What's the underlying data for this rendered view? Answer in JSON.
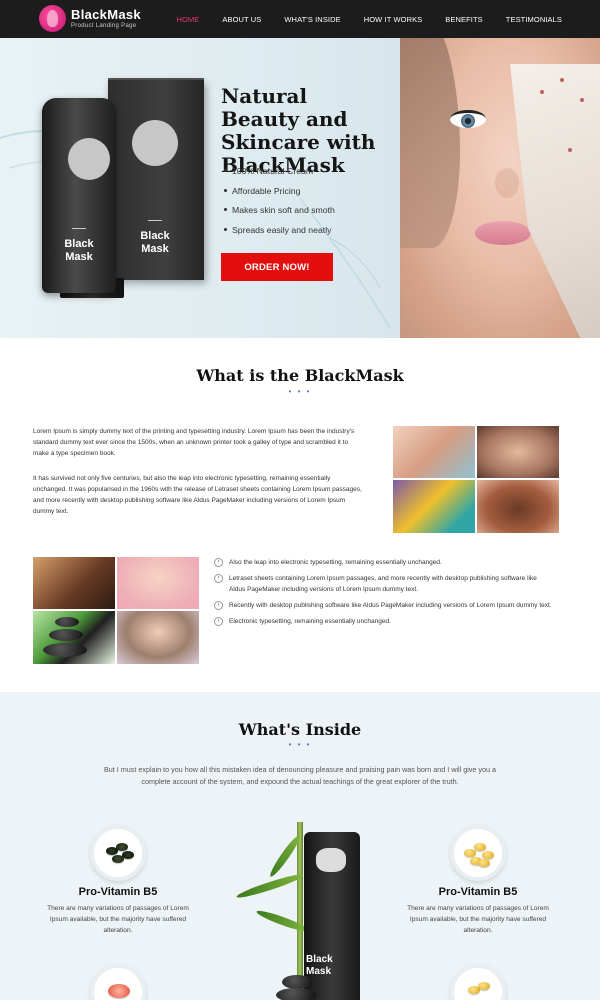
{
  "brand": {
    "name": "BlackMask",
    "tagline": "Product Landing Page"
  },
  "nav": {
    "items": [
      "HOME",
      "ABOUT US",
      "WHAT'S INSIDE",
      "HOW IT WORKS",
      "BENEFITS",
      "TESTIMONIALS"
    ],
    "active": "HOME"
  },
  "hero": {
    "title": "Natural Beauty and Skincare with BlackMask",
    "bullets": [
      "100% Natural Cream",
      "Affordable Pricing",
      "Makes skin soft and smoth",
      "Spreads easily and neatly"
    ],
    "cta": "ORDER NOW!",
    "product_label": "Black Mask"
  },
  "about": {
    "title": "What is the BlackMask",
    "dots": "• • •",
    "para1": "Lorem Ipsum is simply dummy text of the printing and typesetting industry. Lorem Ipsum has been the industry's standard dummy text ever since the 1500s, when an unknown printer took a galley of type and scrambled it to make a type specimen book.",
    "para2": "It has survived not only five centuries, but also the leap into electronic typesetting, remaining essentially unchanged. It was popularised in the 1960s with the release of Letraset sheets containing Lorem Ipsum passages, and more recently with desktop publishing software like Aldus PageMaker including versions of Lorem Ipsum dummy text.",
    "checklist": [
      "Also the leap into electronic typesetting, remaining essentially unchanged.",
      "Letraset sheets containing Lorem Ipsum passages, and more recently with desktop publishing software like Aldus PageMaker including versions of Lorem Ipsum dummy text.",
      "Recently with desktop publishing software like Aldus PageMaker including versions of Lorem Ipsum dummy text.",
      "Electronic typesetting, remaining essentially unchanged."
    ],
    "check_glyph": "›"
  },
  "inside": {
    "title": "What's Inside",
    "dots": "• • •",
    "intro": "But I must explain to you how all this mistaken idea of denouncing pleasure and praising pain was born and I will give you a complete account of the system, and expound the actual teachings of the great explorer of the truth.",
    "features": [
      {
        "title": "Pro-Vitamin B5",
        "desc": "There are many variations of passages of Lorem Ipsum available, but the majority have suffered alteration."
      },
      {
        "title": "Pro-Vitamin B5",
        "desc": "There are many variations of passages of Lorem Ipsum available, but the majority have suffered alteration."
      }
    ],
    "center_label": "Black Mask"
  },
  "colors": {
    "accent": "#e8377a",
    "cta": "#e30e0e",
    "dots": "#5b6fd6",
    "nav_bg": "#1c1c1c"
  }
}
